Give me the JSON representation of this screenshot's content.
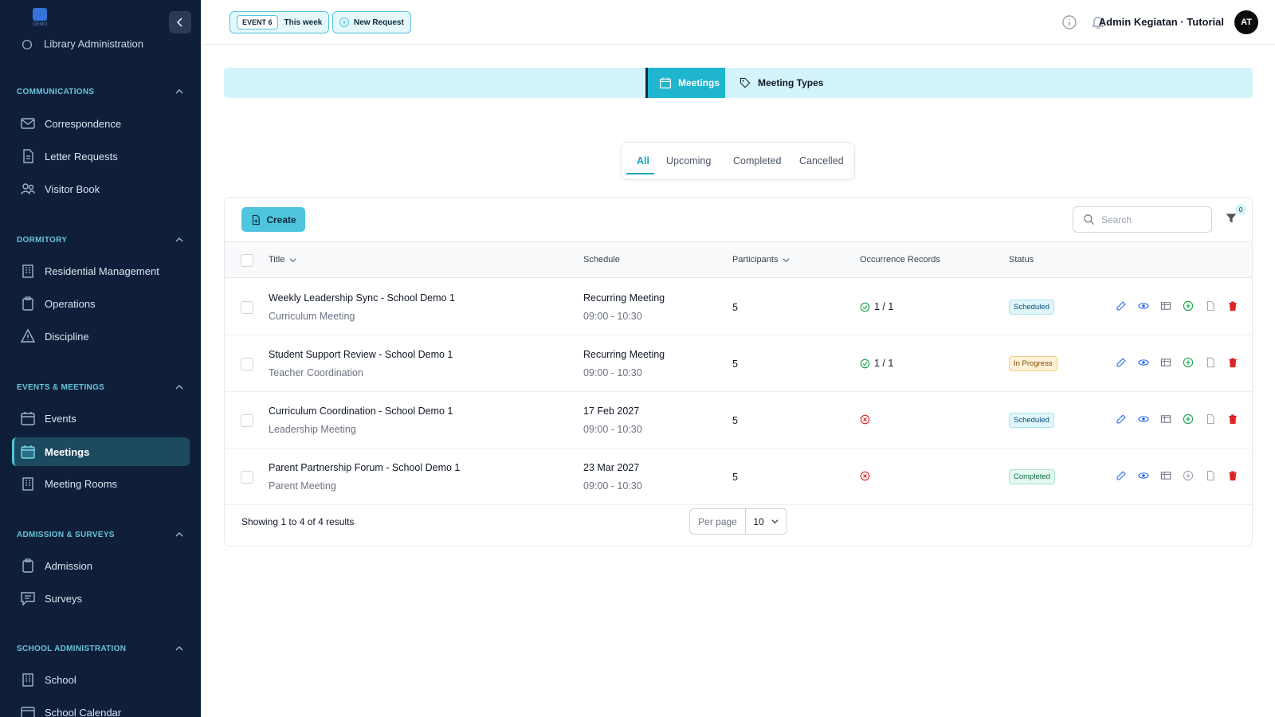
{
  "app": {
    "logo_text": "DEMO",
    "user_name": "Admin Kegiatan · Tutorial",
    "avatar_initials": "AT"
  },
  "topbar": {
    "event_tag": "EVENT 6",
    "event_label": "This week",
    "new_request": "New Request"
  },
  "sidebar": {
    "cut_item": "Library Administration",
    "sections": [
      {
        "title": "COMMUNICATIONS",
        "items": [
          "Correspondence",
          "Letter Requests",
          "Visitor Book"
        ]
      },
      {
        "title": "DORMITORY",
        "items": [
          "Residential Management",
          "Operations",
          "Discipline"
        ]
      },
      {
        "title": "EVENTS & MEETINGS",
        "items": [
          "Events",
          "Meetings",
          "Meeting Rooms"
        ]
      },
      {
        "title": "ADMISSION & SURVEYS",
        "items": [
          "Admission",
          "Surveys"
        ]
      },
      {
        "title": "SCHOOL ADMINISTRATION",
        "items": [
          "School",
          "School Calendar"
        ]
      }
    ],
    "active_item": "Meetings"
  },
  "main_tabs": {
    "active": "Meetings",
    "other": "Meeting Types"
  },
  "filter_tabs": [
    "All",
    "Upcoming",
    "Completed",
    "Cancelled"
  ],
  "filter_active": "All",
  "toolbar": {
    "create_label": "Create",
    "search_placeholder": "Search",
    "filter_count": "0"
  },
  "table": {
    "headers": {
      "title": "Title",
      "schedule": "Schedule",
      "participants": "Participants",
      "occurrence": "Occurrence Records",
      "status": "Status"
    },
    "rows": [
      {
        "title": "Weekly Leadership Sync - School Demo 1",
        "type": "Curriculum Meeting",
        "schedule": "Recurring Meeting",
        "time": "09:00 - 10:30",
        "participants": "5",
        "occurrence": "1 / 1",
        "occurrence_ok": true,
        "status": "Scheduled"
      },
      {
        "title": "Student Support Review - School Demo 1",
        "type": "Teacher Coordination",
        "schedule": "Recurring Meeting",
        "time": "09:00 - 10:30",
        "participants": "5",
        "occurrence": "1 / 1",
        "occurrence_ok": true,
        "status": "In Progress"
      },
      {
        "title": "Curriculum Coordination - School Demo 1",
        "type": "Leadership Meeting",
        "schedule": "17 Feb 2027",
        "time": "09:00 - 10:30",
        "participants": "5",
        "occurrence": "",
        "occurrence_ok": false,
        "status": "Scheduled"
      },
      {
        "title": "Parent Partnership Forum - School Demo 1",
        "type": "Parent Meeting",
        "schedule": "23 Mar 2027",
        "time": "09:00 - 10:30",
        "participants": "5",
        "occurrence": "",
        "occurrence_ok": false,
        "status": "Completed"
      }
    ]
  },
  "pagination": {
    "summary": "Showing 1 to 4 of 4 results",
    "per_page_label": "Per page",
    "per_page_value": "10"
  },
  "colors": {
    "sidebar_bg": "#0f1f3a",
    "accent": "#4fc5dd",
    "accent_dark": "#20b5cf",
    "danger": "#dc2626",
    "success": "#16a34a"
  }
}
